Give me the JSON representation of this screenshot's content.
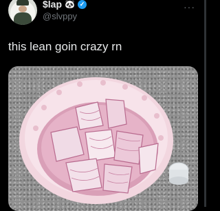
{
  "tweet": {
    "display_name": "$lap",
    "name_emoji": "🐼",
    "handle": "@slvppy",
    "text": "this lean goin crazy rn",
    "more_icon": "ellipsis-icon",
    "verified_icon": "verified-badge-icon"
  },
  "colors": {
    "background": "#000000",
    "text": "#e7e9ea",
    "secondary_text": "#71767b",
    "verified": "#1d9bf0"
  }
}
